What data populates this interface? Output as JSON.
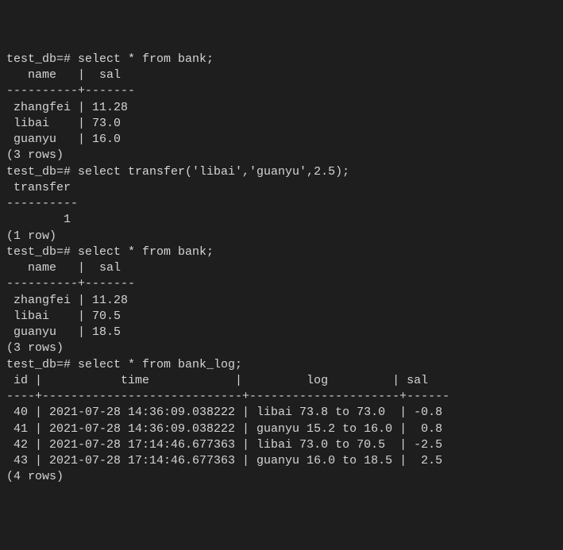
{
  "prompt": "test_db=#",
  "queries": {
    "q1": "select * from bank;",
    "q2": "select transfer('libai','guanyu',2.5);",
    "q3": "select * from bank;",
    "q4": "select * from bank_log;"
  },
  "bank1": {
    "header_name": "   name   ",
    "header_sal": "  sal",
    "sep": "----------+-------",
    "rows": [
      {
        "name": " zhangfei ",
        "sal": " 11.28"
      },
      {
        "name": " libai    ",
        "sal": " 73.0"
      },
      {
        "name": " guanyu   ",
        "sal": " 16.0"
      }
    ],
    "count": "(3 rows)"
  },
  "transfer": {
    "header": " transfer",
    "sep": "----------",
    "value": "        1",
    "count": "(1 row)"
  },
  "bank2": {
    "header_name": "   name   ",
    "header_sal": "  sal",
    "sep": "----------+-------",
    "rows": [
      {
        "name": " zhangfei ",
        "sal": " 11.28"
      },
      {
        "name": " libai    ",
        "sal": " 70.5"
      },
      {
        "name": " guanyu   ",
        "sal": " 18.5"
      }
    ],
    "count": "(3 rows)"
  },
  "banklog": {
    "header_id": " id ",
    "header_time": "           time            ",
    "header_log": "         log         ",
    "header_sal": " sal",
    "sep": "----+----------------------------+---------------------+------",
    "rows": [
      {
        "id": " 40 ",
        "time": " 2021-07-28 14:36:09.038222 ",
        "log": " libai 73.8 to 73.0  ",
        "sal": " -0.8"
      },
      {
        "id": " 41 ",
        "time": " 2021-07-28 14:36:09.038222 ",
        "log": " guanyu 15.2 to 16.0 ",
        "sal": "  0.8"
      },
      {
        "id": " 42 ",
        "time": " 2021-07-28 17:14:46.677363 ",
        "log": " libai 73.0 to 70.5  ",
        "sal": " -2.5"
      },
      {
        "id": " 43 ",
        "time": " 2021-07-28 17:14:46.677363 ",
        "log": " guanyu 16.0 to 18.5 ",
        "sal": "  2.5"
      }
    ],
    "count": "(4 rows)"
  }
}
